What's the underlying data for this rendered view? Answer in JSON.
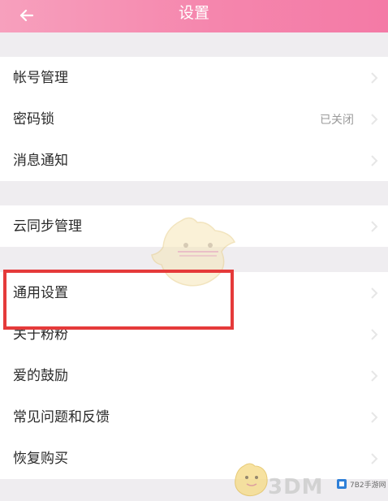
{
  "header": {
    "title": "设置",
    "background_start": "#f7a0bd",
    "background_end": "#f47aa6"
  },
  "groups": [
    {
      "items": [
        {
          "label": "帐号管理"
        },
        {
          "label": "密码锁",
          "value": "已关闭"
        },
        {
          "label": "消息通知"
        }
      ]
    },
    {
      "items": [
        {
          "label": "云同步管理"
        }
      ]
    },
    {
      "items": [
        {
          "label": "通用设置"
        },
        {
          "label": "关于粉粉"
        },
        {
          "label": "爱的鼓励"
        },
        {
          "label": "常见问题和反馈"
        },
        {
          "label": "恢复购买"
        }
      ]
    }
  ],
  "highlight": {
    "target": "通用设置",
    "color": "#e53a3a"
  },
  "watermark": {
    "text": "3DM",
    "site_text": "7B2手游网"
  }
}
